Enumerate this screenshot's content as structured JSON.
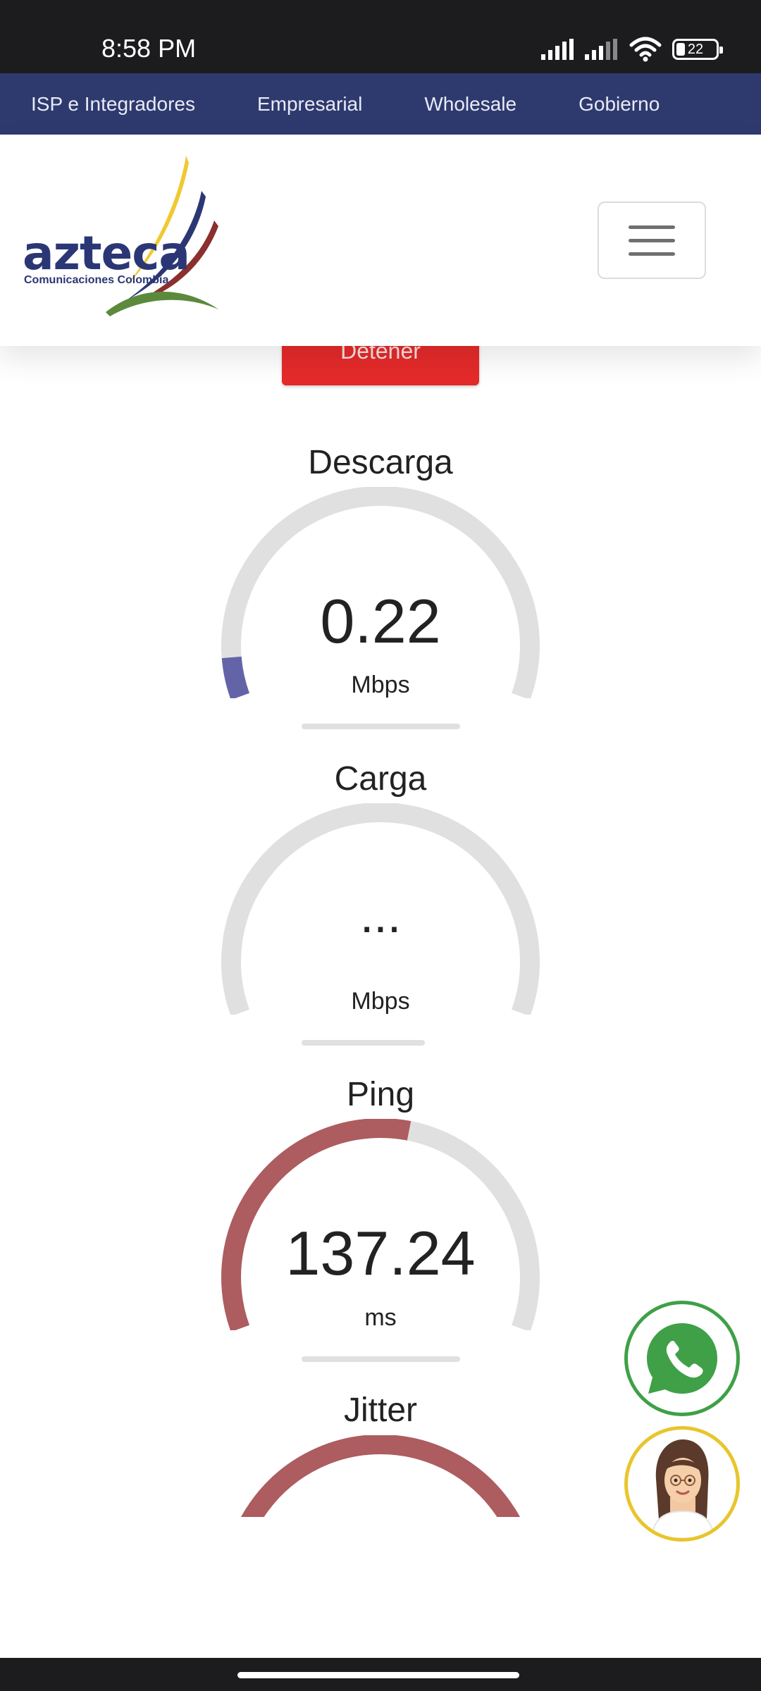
{
  "status": {
    "time": "8:58 PM",
    "battery": "22"
  },
  "nav": {
    "links": [
      "ISP e Integradores",
      "Empresarial",
      "Wholesale",
      "Gobierno"
    ]
  },
  "brand": {
    "name": "azteca",
    "subtitle": "Comunicaciones Colombia"
  },
  "test": {
    "stop_label": "Detener"
  },
  "gauges": {
    "download": {
      "title": "Descarga",
      "value": "0.22",
      "unit": "Mbps",
      "fraction": 0.07,
      "color": "#6364a8"
    },
    "upload": {
      "title": "Carga",
      "value": "...",
      "unit": "Mbps",
      "fraction": 0.0,
      "color": "#6364a8"
    },
    "ping": {
      "title": "Ping",
      "value": "137.24",
      "unit": "ms",
      "fraction": 0.55,
      "color": "#ad5c5f"
    },
    "jitter": {
      "title": "Jitter",
      "color": "#ad5c5f"
    }
  },
  "colors": {
    "nav_bg": "#2e3a6e",
    "stop_button": "#e52a2a",
    "gauge_track": "#e0e0e0",
    "whatsapp": "#3fa047",
    "assistant_ring": "#e8c52c"
  }
}
